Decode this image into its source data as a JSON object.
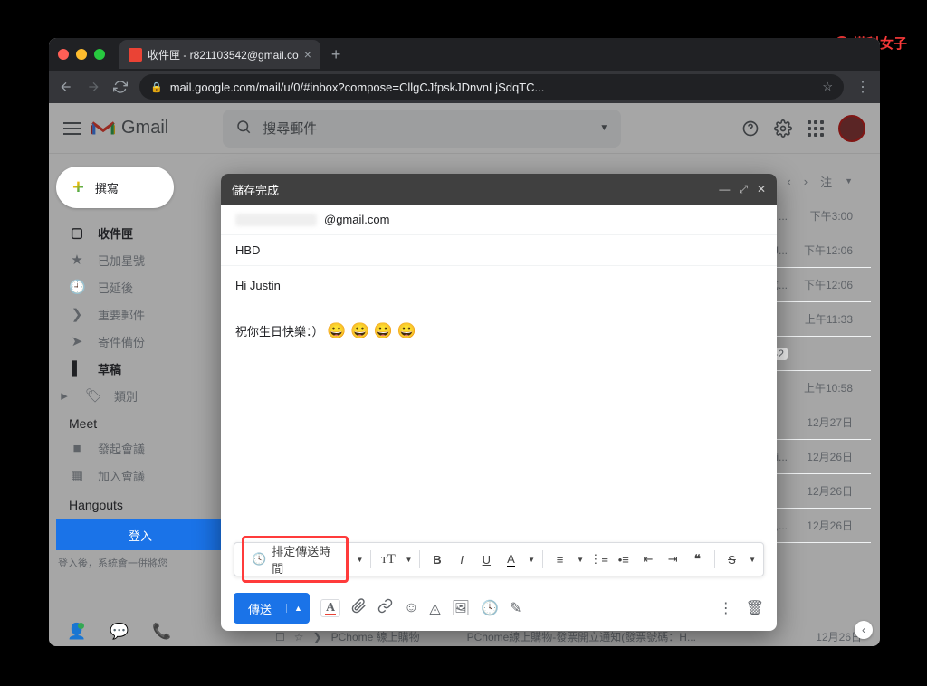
{
  "watermark": "塔科女子",
  "browser": {
    "tab_title": "收件匣 - r821103542@gmail.co",
    "url": "mail.google.com/mail/u/0/#inbox?compose=CllgCJfpskJDnvnLjSdqTC..."
  },
  "gmail": {
    "brand": "Gmail",
    "search_placeholder": "搜尋郵件",
    "compose_label": "撰寫",
    "sidebar": [
      {
        "icon": "▢",
        "label": "收件匣",
        "active": true
      },
      {
        "icon": "★",
        "label": "已加星號"
      },
      {
        "icon": "🕘",
        "label": "已延後"
      },
      {
        "icon": "❯",
        "label": "重要郵件"
      },
      {
        "icon": "➤",
        "label": "寄件備份"
      },
      {
        "icon": "▌",
        "label": "草稿",
        "bold": true
      },
      {
        "icon": "🏷",
        "label": "類別"
      }
    ],
    "meet": {
      "header": "Meet",
      "items": [
        "發起會議",
        "加入會議"
      ]
    },
    "hangouts": {
      "header": "Hangouts",
      "login": "登入",
      "note": "登入後，系統會一併將您"
    },
    "toolbar_right": "注",
    "mail_times": [
      "下午3:00",
      "下午12:06",
      "下午12:06",
      "上午11:33",
      "",
      "上午10:58",
      "12月27日",
      "12月26日",
      "12月26日",
      "12月26日"
    ],
    "last_row": {
      "sender": "PChome 線上購物",
      "subject": "PChome線上購物-發票開立通知(發票號碼：H...",
      "time": "12月26日"
    }
  },
  "compose": {
    "header": "儲存完成",
    "to_suffix": "@gmail.com",
    "subject": "HBD",
    "body_line1": "Hi Justin",
    "body_line2": "祝你生日快樂：）",
    "emojis": "😀 😀 😀 😀",
    "schedule_label": "排定傳送時間",
    "send_label": "傳送"
  }
}
